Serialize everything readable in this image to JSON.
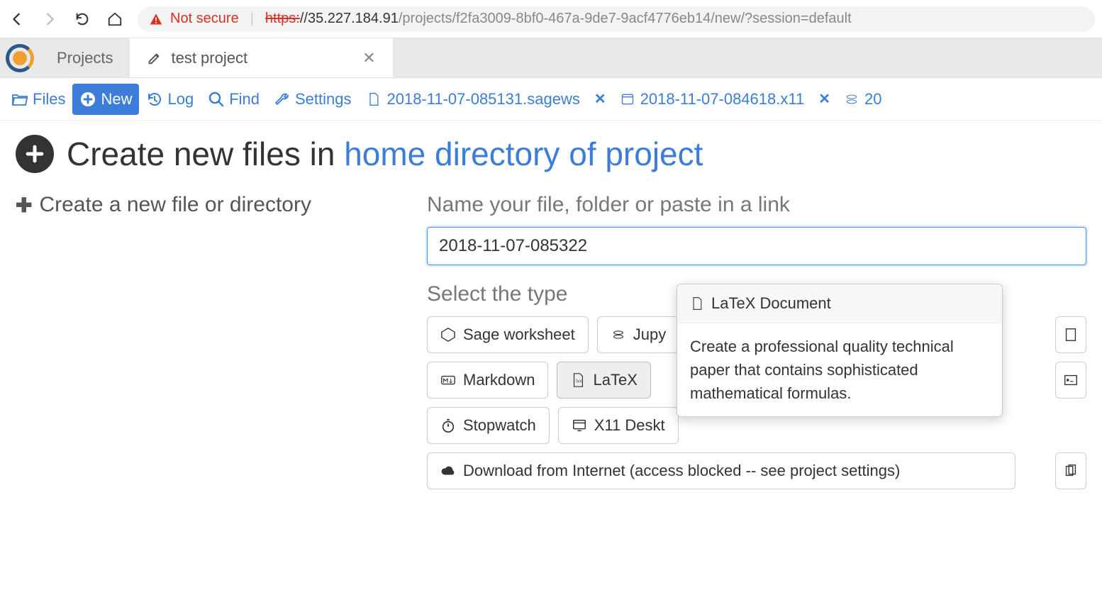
{
  "browser": {
    "not_secure": "Not secure",
    "url": {
      "scheme": "https:",
      "host": "//35.227.184.91",
      "path": "/projects/f2fa3009-8bf0-467a-9de7-9acf4776eb14/new/?session=default"
    }
  },
  "tabs": {
    "projects": "Projects",
    "active": "test project"
  },
  "toolbar": {
    "files": "Files",
    "new": "New",
    "log": "Log",
    "find": "Find",
    "settings": "Settings",
    "file1": "2018-11-07-085131.sagews",
    "file2": "2018-11-07-084618.x11",
    "file3": "20"
  },
  "page": {
    "title_prefix": "Create new files in ",
    "title_link": "home directory of project",
    "left_heading": "Create a new file or directory",
    "name_label": "Name your file, folder or paste in a link",
    "name_value": "2018-11-07-085322",
    "type_label": "Select the type"
  },
  "types": {
    "sage": "Sage worksheet",
    "jupyter": "Jupy",
    "markdown": "Markdown",
    "latex": "LaTeX",
    "stopwatch": "Stopwatch",
    "x11": "X11 Deskt",
    "download": "Download from Internet (access blocked -- see project settings)"
  },
  "tooltip": {
    "title": "LaTeX Document",
    "body": "Create a professional quality technical paper that contains sophisticated mathematical formulas."
  }
}
